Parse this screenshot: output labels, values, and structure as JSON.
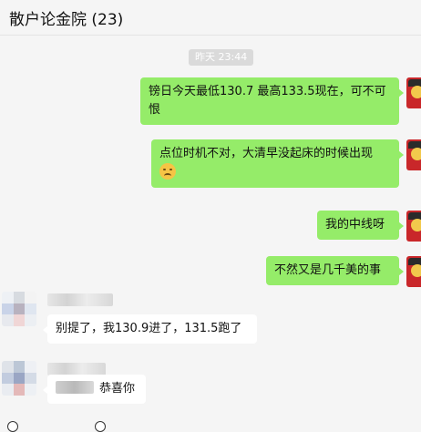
{
  "header": {
    "title": "散户论金院 (23)"
  },
  "timestamp": "昨天 23:44",
  "messages": [
    {
      "id": "m1",
      "text": "镑日今天最低130.7   最高133.5现在，可不可恨"
    },
    {
      "id": "m2",
      "text": "点位时机不对，大清早没起床的时候出现",
      "emoji": "sad-face-emoji"
    },
    {
      "id": "m3",
      "text": "我的中线呀"
    },
    {
      "id": "m4",
      "text": "不然又是几千美的事"
    },
    {
      "id": "m5",
      "text": "别提了，我130.9进了，131.5跑了"
    },
    {
      "id": "m6",
      "text": "恭喜你"
    }
  ],
  "colors": {
    "outgoing_bubble": "#95ec69",
    "incoming_bubble": "#ffffff",
    "background": "#f5f5f5"
  }
}
